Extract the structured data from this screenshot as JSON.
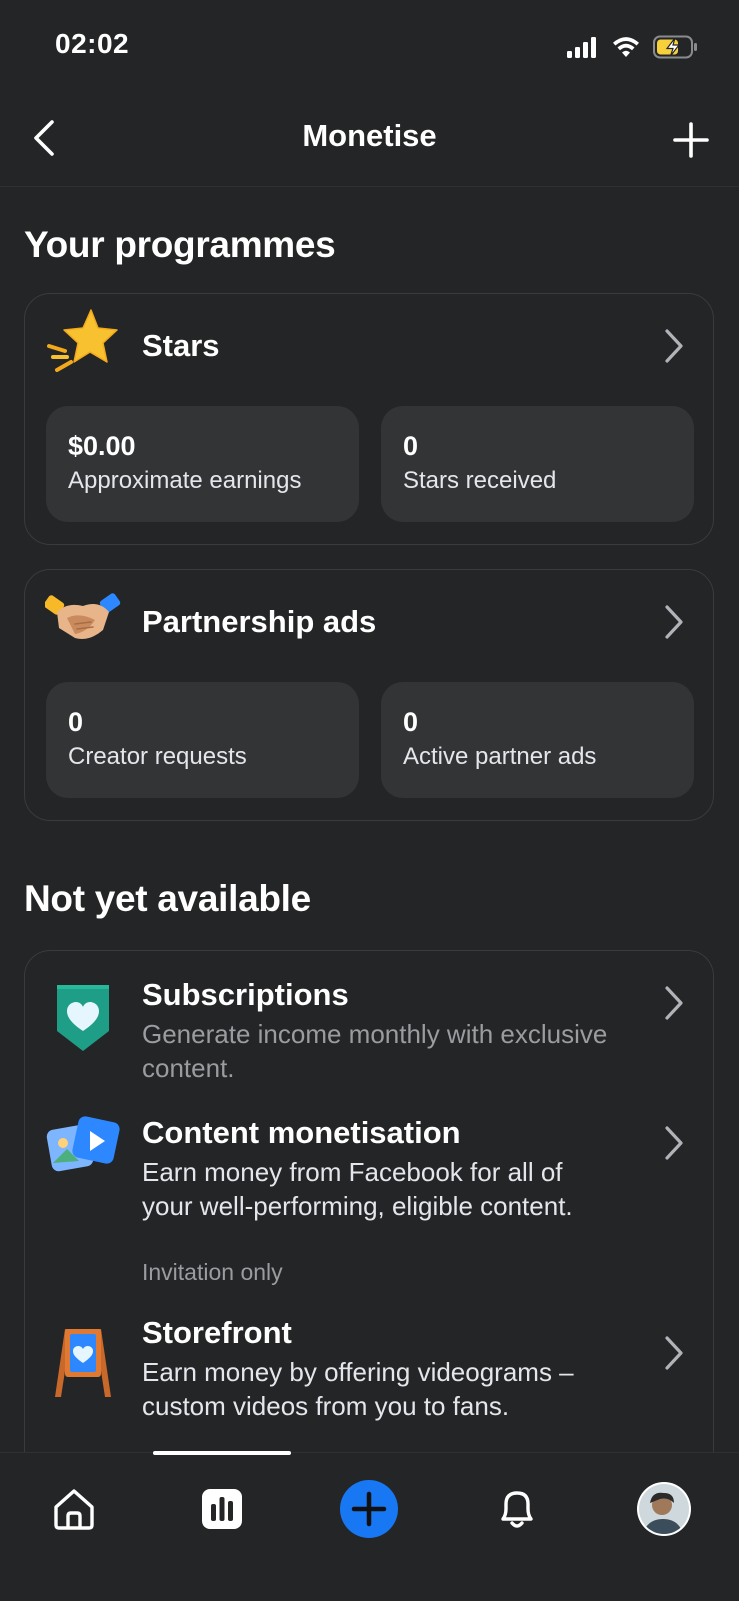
{
  "status_bar": {
    "time": "02:02"
  },
  "header": {
    "title": "Monetise"
  },
  "programmes": {
    "title": "Your programmes",
    "stars": {
      "title": "Stars",
      "tiles": [
        {
          "value": "$0.00",
          "label": "Approximate earnings"
        },
        {
          "value": "0",
          "label": "Stars received"
        }
      ]
    },
    "partnership": {
      "title": "Partnership ads",
      "tiles": [
        {
          "value": "0",
          "label": "Creator requests"
        },
        {
          "value": "0",
          "label": "Active partner ads"
        }
      ]
    }
  },
  "not_available": {
    "title": "Not yet available",
    "items": [
      {
        "title": "Subscriptions",
        "desc": "Generate income monthly with exclusive content."
      },
      {
        "title": "Content monetisation",
        "desc": "Earn money from Facebook for all of your well-performing, eligible content.",
        "note": "Invitation only"
      },
      {
        "title": "Storefront",
        "desc": "Earn money by offering videograms – custom videos from you to fans."
      }
    ]
  },
  "nav": {
    "items": [
      "home-icon",
      "insights-icon",
      "create-icon",
      "notifications-icon",
      "profile-avatar"
    ]
  },
  "colors": {
    "background": "#242526",
    "tile": "#333436",
    "accent": "#1877f2"
  }
}
